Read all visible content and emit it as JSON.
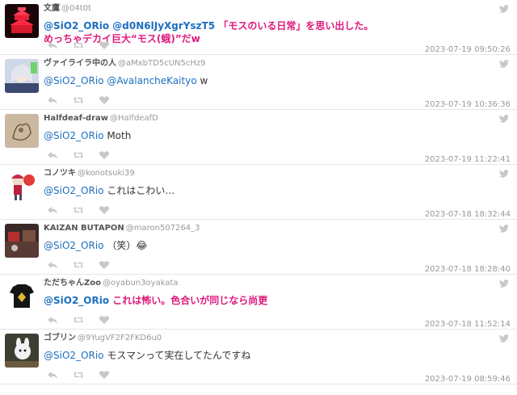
{
  "tweets": [
    {
      "name": "文鷹",
      "handle": "@04t0t",
      "highlight": true,
      "mentions": [
        "@SiO2_ORio",
        "@d0N6lJyXgrYszT5"
      ],
      "text": "「モスのいる日常」を思い出した。",
      "text2": "めっちゃデカイ巨大“モス(蛾)”だw",
      "time": "2023-07-19 09:50:26",
      "avatar": "red-castle-avatar"
    },
    {
      "name": "ヴァイライラ中の人",
      "handle": "@aMxbTD5cUN5cHz9",
      "highlight": false,
      "mentions": [
        "@SiO2_ORio",
        "@AvalancheKaityo"
      ],
      "text": "w",
      "time": "2023-07-19 10:36:36",
      "avatar": "anime-girl-avatar"
    },
    {
      "name": "Halfdeaf-draw",
      "handle": "@HalfdeafD",
      "highlight": false,
      "mentions": [
        "@SiO2_ORio"
      ],
      "text": "Moth",
      "time": "2023-07-19 11:22:41",
      "avatar": "sketch-avatar"
    },
    {
      "name": "コノツキ",
      "handle": "@konotsuki39",
      "highlight": false,
      "mentions": [
        "@SiO2_ORio"
      ],
      "text": "これはこわい…",
      "time": "2023-07-18 18:32:44",
      "avatar": "chibi-avatar"
    },
    {
      "name": "KAIZAN BUTAPON",
      "handle": "@maron507264_3",
      "highlight": false,
      "mentions": [
        "@SiO2_ORio"
      ],
      "text": "（笑）😂",
      "time": "2023-07-18 18:28:40",
      "avatar": "street-avatar"
    },
    {
      "name": "ただちゃんZoo",
      "handle": "@oyabun3oyakata",
      "highlight": true,
      "mentions": [
        "@SiO2_ORio"
      ],
      "text": "これは怖い。色合いが同じなら尚更",
      "time": "2023-07-18 11:52:14",
      "avatar": "tshirt-avatar"
    },
    {
      "name": "ゴブリン",
      "handle": "@9YugVF2F2FKD6u0",
      "highlight": false,
      "mentions": [
        "@SiO2_ORio"
      ],
      "text": "モスマンって実在してたんですね",
      "time": "2023-07-19 08:59:46",
      "avatar": "plush-avatar"
    }
  ],
  "colors": {
    "mention": "#1d6fbf",
    "highlight_text": "#e0197d",
    "icon": "#c8c8c8",
    "divider": "#e6e6e6"
  },
  "icons": {
    "reply": "reply-icon",
    "retweet": "retweet-icon",
    "like": "heart-icon",
    "bird": "bird-icon"
  }
}
